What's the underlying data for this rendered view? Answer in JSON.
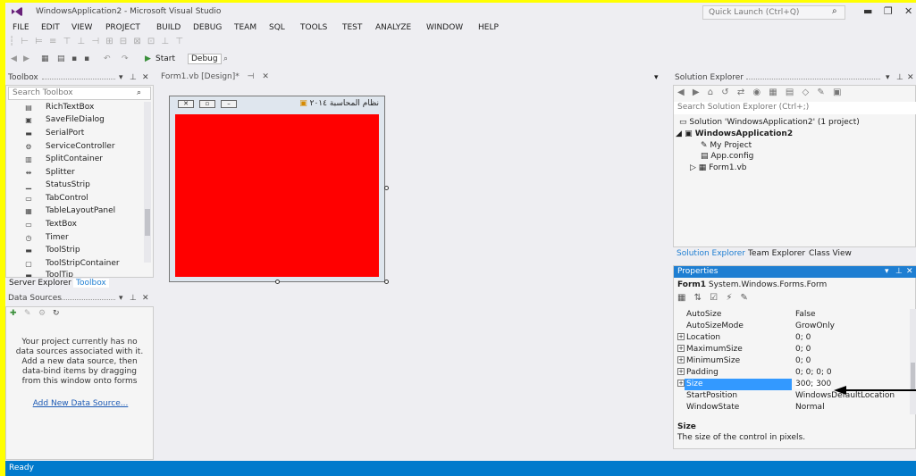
{
  "app": {
    "title": "WindowsApplication2 - Microsoft Visual Studio",
    "quick_launch_placeholder": "Quick Launch (Ctrl+Q)",
    "status": "Ready"
  },
  "menu": [
    "FILE",
    "EDIT",
    "VIEW",
    "PROJECT",
    "BUILD",
    "DEBUG",
    "TEAM",
    "SQL",
    "TOOLS",
    "TEST",
    "ANALYZE",
    "WINDOW",
    "HELP"
  ],
  "toolbar": {
    "start_label": "Start",
    "config_label": "Debug"
  },
  "toolbox": {
    "title": "Toolbox",
    "search_placeholder": "Search Toolbox",
    "items": [
      "RichTextBox",
      "SaveFileDialog",
      "SerialPort",
      "ServiceController",
      "SplitContainer",
      "Splitter",
      "StatusStrip",
      "TabControl",
      "TableLayoutPanel",
      "TextBox",
      "Timer",
      "ToolStrip",
      "ToolStripContainer",
      "ToolTip"
    ],
    "tabs": [
      "Server Explorer",
      "Toolbox"
    ]
  },
  "data_sources": {
    "title": "Data Sources",
    "message": "Your project currently has no data sources associated with it. Add a new data source, then data-bind items by dragging from this window onto forms",
    "link": "Add New Data Source..."
  },
  "designer": {
    "tab_label": "Form1.vb [Design]*",
    "form_title": "نظام المحاسبة ٢٠١٤",
    "form_color": "#ff0000"
  },
  "solution_explorer": {
    "title": "Solution Explorer",
    "search_placeholder": "Search Solution Explorer (Ctrl+;)",
    "solution": "Solution 'WindowsApplication2' (1 project)",
    "project": "WindowsApplication2",
    "items": [
      "My Project",
      "App.config",
      "Form1.vb"
    ],
    "tabs": [
      "Solution Explorer",
      "Team Explorer",
      "Class View"
    ]
  },
  "properties": {
    "title": "Properties",
    "object_name": "Form1",
    "object_type": "System.Windows.Forms.Form",
    "rows": [
      {
        "name": "AutoSize",
        "value": "False"
      },
      {
        "name": "AutoSizeMode",
        "value": "GrowOnly"
      },
      {
        "name": "Location",
        "value": "0; 0"
      },
      {
        "name": "MaximumSize",
        "value": "0; 0"
      },
      {
        "name": "MinimumSize",
        "value": "0; 0"
      },
      {
        "name": "Padding",
        "value": "0; 0; 0; 0"
      },
      {
        "name": "Size",
        "value": "300; 300"
      },
      {
        "name": "StartPosition",
        "value": "WindowsDefaultLocation"
      },
      {
        "name": "WindowState",
        "value": "Normal"
      }
    ],
    "desc_name": "Size",
    "desc_text": "The size of the control in pixels."
  }
}
